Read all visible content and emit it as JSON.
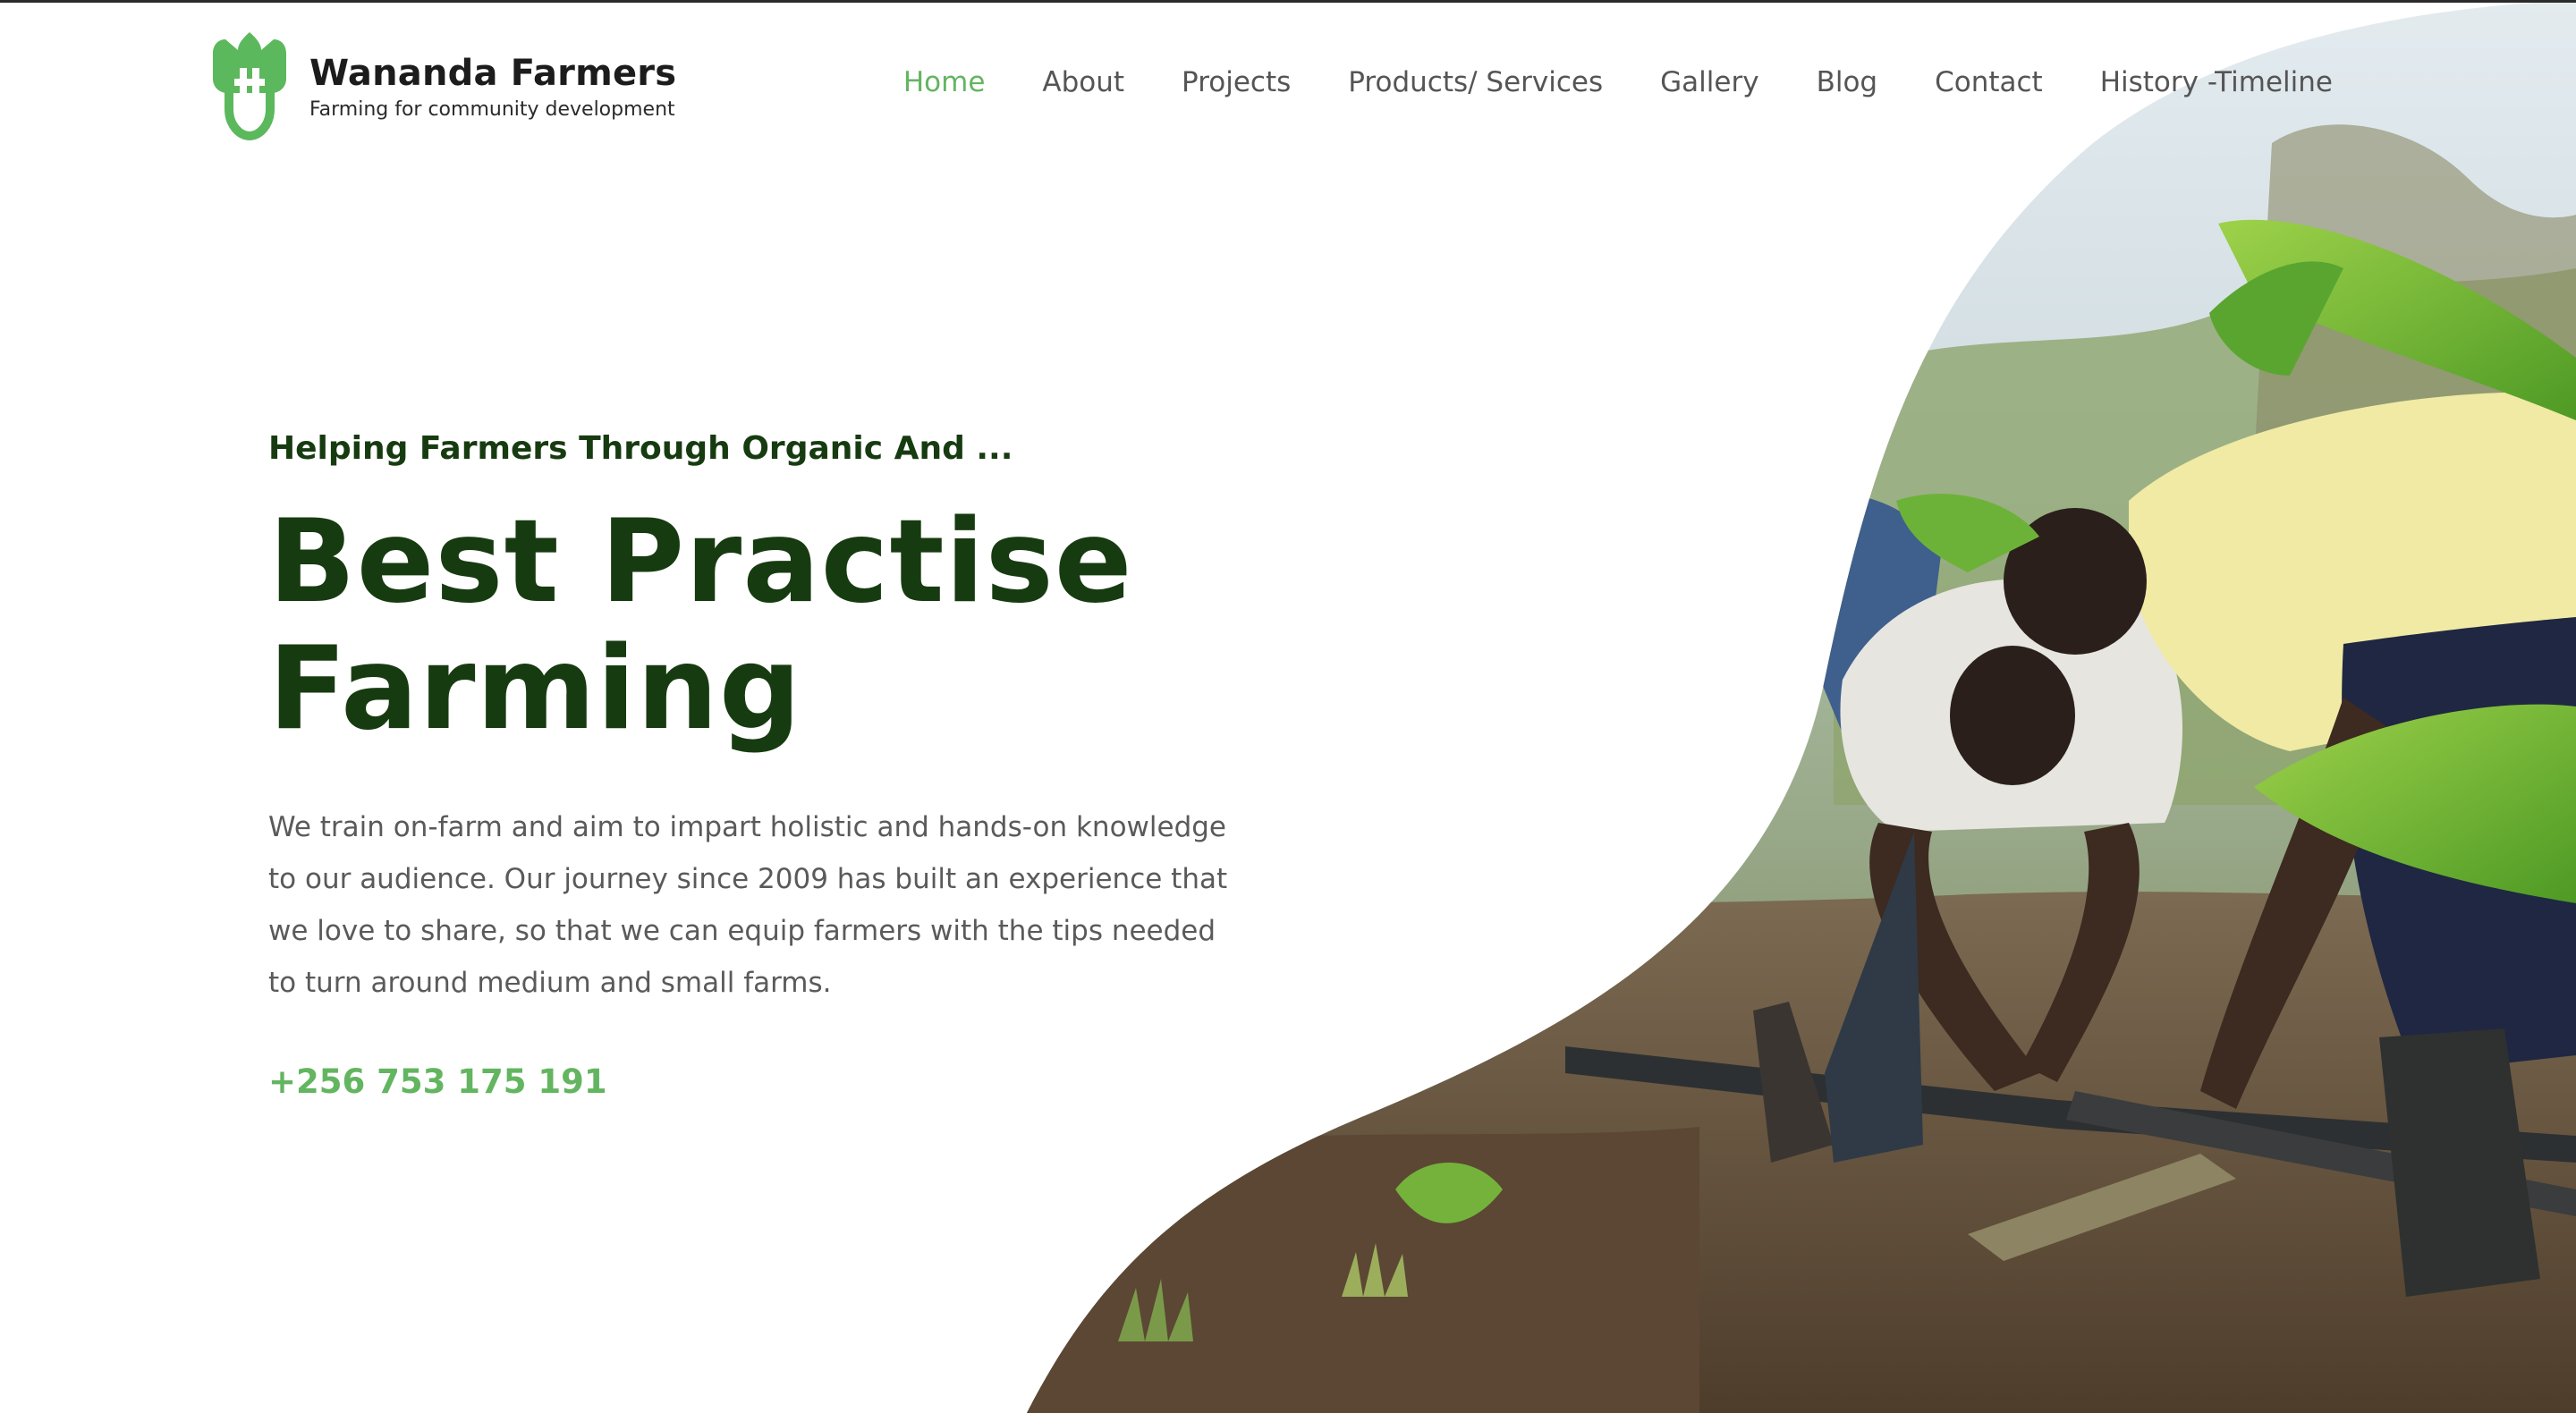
{
  "brand": {
    "name": "Wananda Farmers",
    "tagline": "Farming for community development",
    "logo_icon": "leaf-plug-logo-icon",
    "accent_color": "#63b560",
    "dark_color": "#173b10"
  },
  "nav": {
    "items": [
      {
        "label": "Home",
        "active": true
      },
      {
        "label": "About",
        "active": false
      },
      {
        "label": "Projects",
        "active": false
      },
      {
        "label": "Products/ Services",
        "active": false
      },
      {
        "label": "Gallery",
        "active": false
      },
      {
        "label": "Blog",
        "active": false
      },
      {
        "label": "Contact",
        "active": false
      },
      {
        "label": "History -Timeline",
        "active": false
      }
    ]
  },
  "hero": {
    "eyebrow": "Helping Farmers Through Organic And ...",
    "headline_line1": "Best Practise",
    "headline_line2": "Farming",
    "body": "We train on-farm and aim to impart holistic and hands-on knowledge to our audience.  Our journey since 2009 has built an experience that we love to share, so that we can equip farmers with the tips needed to turn around medium and small farms.",
    "phone": "+256 753 175 191",
    "image": "farmers-fixing-irrigation-pipe-photo"
  }
}
